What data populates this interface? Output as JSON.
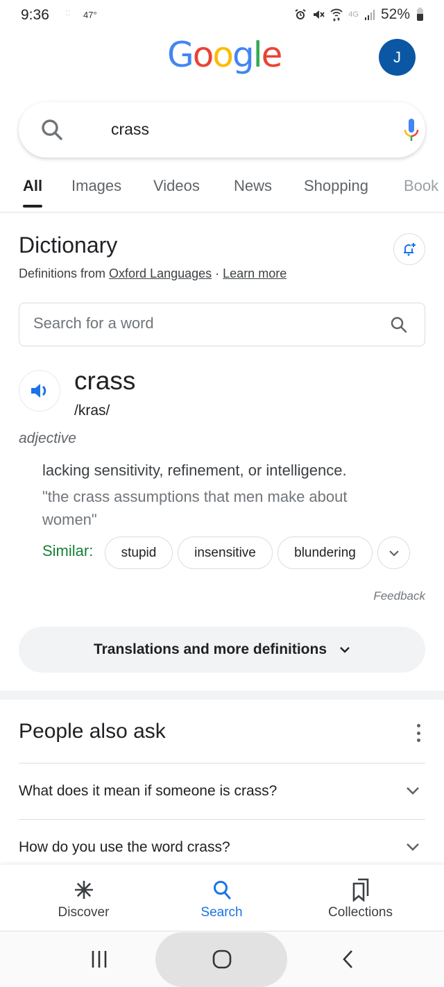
{
  "status_bar": {
    "time": "9:36",
    "temperature": "47°",
    "battery_percent": "52%",
    "icons": [
      "alarm-icon",
      "mute-icon",
      "wifi-icon",
      "4g-icon",
      "signal-icon",
      "battery-icon"
    ]
  },
  "header": {
    "logo_letters": [
      "G",
      "o",
      "o",
      "g",
      "l",
      "e"
    ],
    "avatar_initial": "J"
  },
  "search": {
    "query": "crass"
  },
  "tabs": [
    {
      "label": "All",
      "active": true
    },
    {
      "label": "Images"
    },
    {
      "label": "Videos"
    },
    {
      "label": "News"
    },
    {
      "label": "Shopping"
    },
    {
      "label": "Book"
    }
  ],
  "dictionary": {
    "title": "Dictionary",
    "source_prefix": "Definitions from ",
    "source_link": "Oxford Languages",
    "separator": " · ",
    "learn_more": "Learn more",
    "search_placeholder": "Search for a word",
    "headword": "crass",
    "phonetic": "/kras/",
    "part_of_speech": "adjective",
    "definition": "lacking sensitivity, refinement, or intelligence.",
    "example": "\"the crass assumptions that men make about women\"",
    "similar_label": "Similar:",
    "similar": [
      "stupid",
      "insensitive",
      "blundering"
    ],
    "feedback": "Feedback",
    "more_definitions": "Translations and more definitions"
  },
  "people_also_ask": {
    "title": "People also ask",
    "questions": [
      "What does it mean if someone is crass?",
      "How do you use the word crass?"
    ]
  },
  "bottom_nav": [
    {
      "label": "Discover",
      "icon": "asterisk-icon"
    },
    {
      "label": "Search",
      "icon": "search-icon",
      "active": true
    },
    {
      "label": "Collections",
      "icon": "collections-icon"
    }
  ],
  "colors": {
    "accent_blue": "#1a73e8",
    "avatar_bg": "#0b57a4",
    "similar_green": "#188038"
  }
}
